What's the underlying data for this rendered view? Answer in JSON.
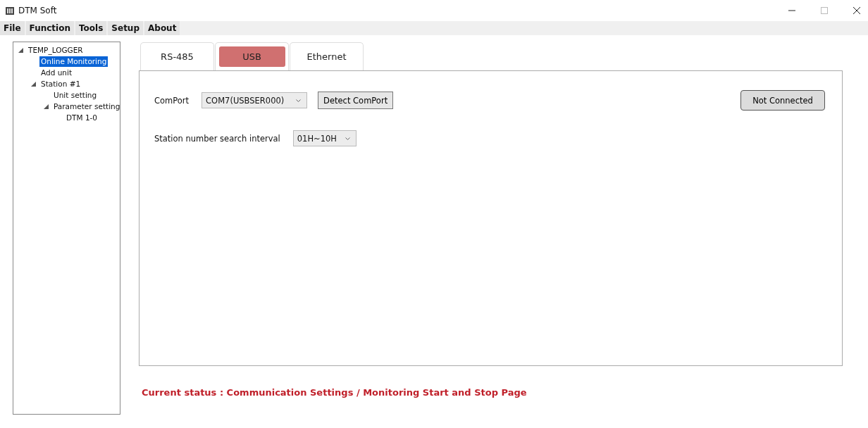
{
  "window": {
    "title": "DTM Soft"
  },
  "menu": [
    "File",
    "Function",
    "Tools",
    "Setup",
    "About"
  ],
  "tree": [
    {
      "label": "TEMP_LOGGER",
      "expanded": true,
      "selected": false,
      "children": [
        {
          "label": "Online Monitoring",
          "selected": true
        },
        {
          "label": "Add unit",
          "selected": false
        },
        {
          "label": "Station #1",
          "expanded": true,
          "selected": false,
          "children": [
            {
              "label": "Unit setting",
              "selected": false
            },
            {
              "label": "Parameter setting",
              "expanded": true,
              "selected": false,
              "children": [
                {
                  "label": "DTM 1-0",
                  "selected": false
                }
              ]
            }
          ]
        }
      ]
    }
  ],
  "tabs": [
    {
      "label": "RS-485",
      "selected": false
    },
    {
      "label": "USB",
      "selected": true
    },
    {
      "label": "Ethernet",
      "selected": false
    }
  ],
  "comport": {
    "label": "ComPort",
    "value": "COM7(USBSER000)",
    "button": "Detect ComPort"
  },
  "connection_button": "Not Connected",
  "interval": {
    "label": "Station number search interval",
    "value": "01H~10H"
  },
  "status": "Current status : Communication Settings / Monitoring Start and Stop Page"
}
